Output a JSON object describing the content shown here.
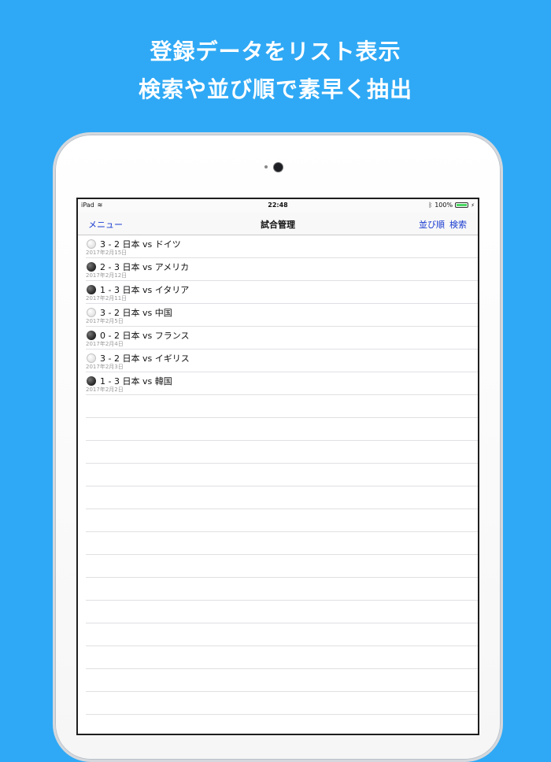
{
  "headline": {
    "line1": "登録データをリスト表示",
    "line2": "検索や並び順で素早く抽出"
  },
  "status_bar": {
    "device": "iPad",
    "time": "22:48",
    "battery": "100%",
    "battery_level": 1.0
  },
  "navbar": {
    "menu_label": "メニュー",
    "title": "試合管理",
    "sort_label": "並び順",
    "search_label": "検索"
  },
  "matches": [
    {
      "result": "white",
      "score": "3 - 2",
      "teams": "日本 vs ドイツ",
      "date": "2017年2月15日"
    },
    {
      "result": "black",
      "score": "2 - 3",
      "teams": "日本 vs アメリカ",
      "date": "2017年2月12日"
    },
    {
      "result": "black",
      "score": "1 - 3",
      "teams": "日本 vs イタリア",
      "date": "2017年2月11日"
    },
    {
      "result": "white",
      "score": "3 - 2",
      "teams": "日本 vs 中国",
      "date": "2017年2月5日"
    },
    {
      "result": "black",
      "score": "0 - 2",
      "teams": "日本 vs フランス",
      "date": "2017年2月4日"
    },
    {
      "result": "white",
      "score": "3 - 2",
      "teams": "日本 vs イギリス",
      "date": "2017年2月3日"
    },
    {
      "result": "black",
      "score": "1 - 3",
      "teams": "日本 vs 韓国",
      "date": "2017年2月2日"
    }
  ],
  "icons": {
    "wifi": "wifi-icon",
    "bluetooth": "bluetooth-icon",
    "battery": "battery-icon",
    "charging": "charging-bolt-icon",
    "white_ball": "white-ball-icon",
    "black_ball": "black-ball-icon"
  },
  "colors": {
    "background": "#2fa9f5",
    "nav_link": "#1a3cd1",
    "battery_fill": "#4cd964"
  }
}
